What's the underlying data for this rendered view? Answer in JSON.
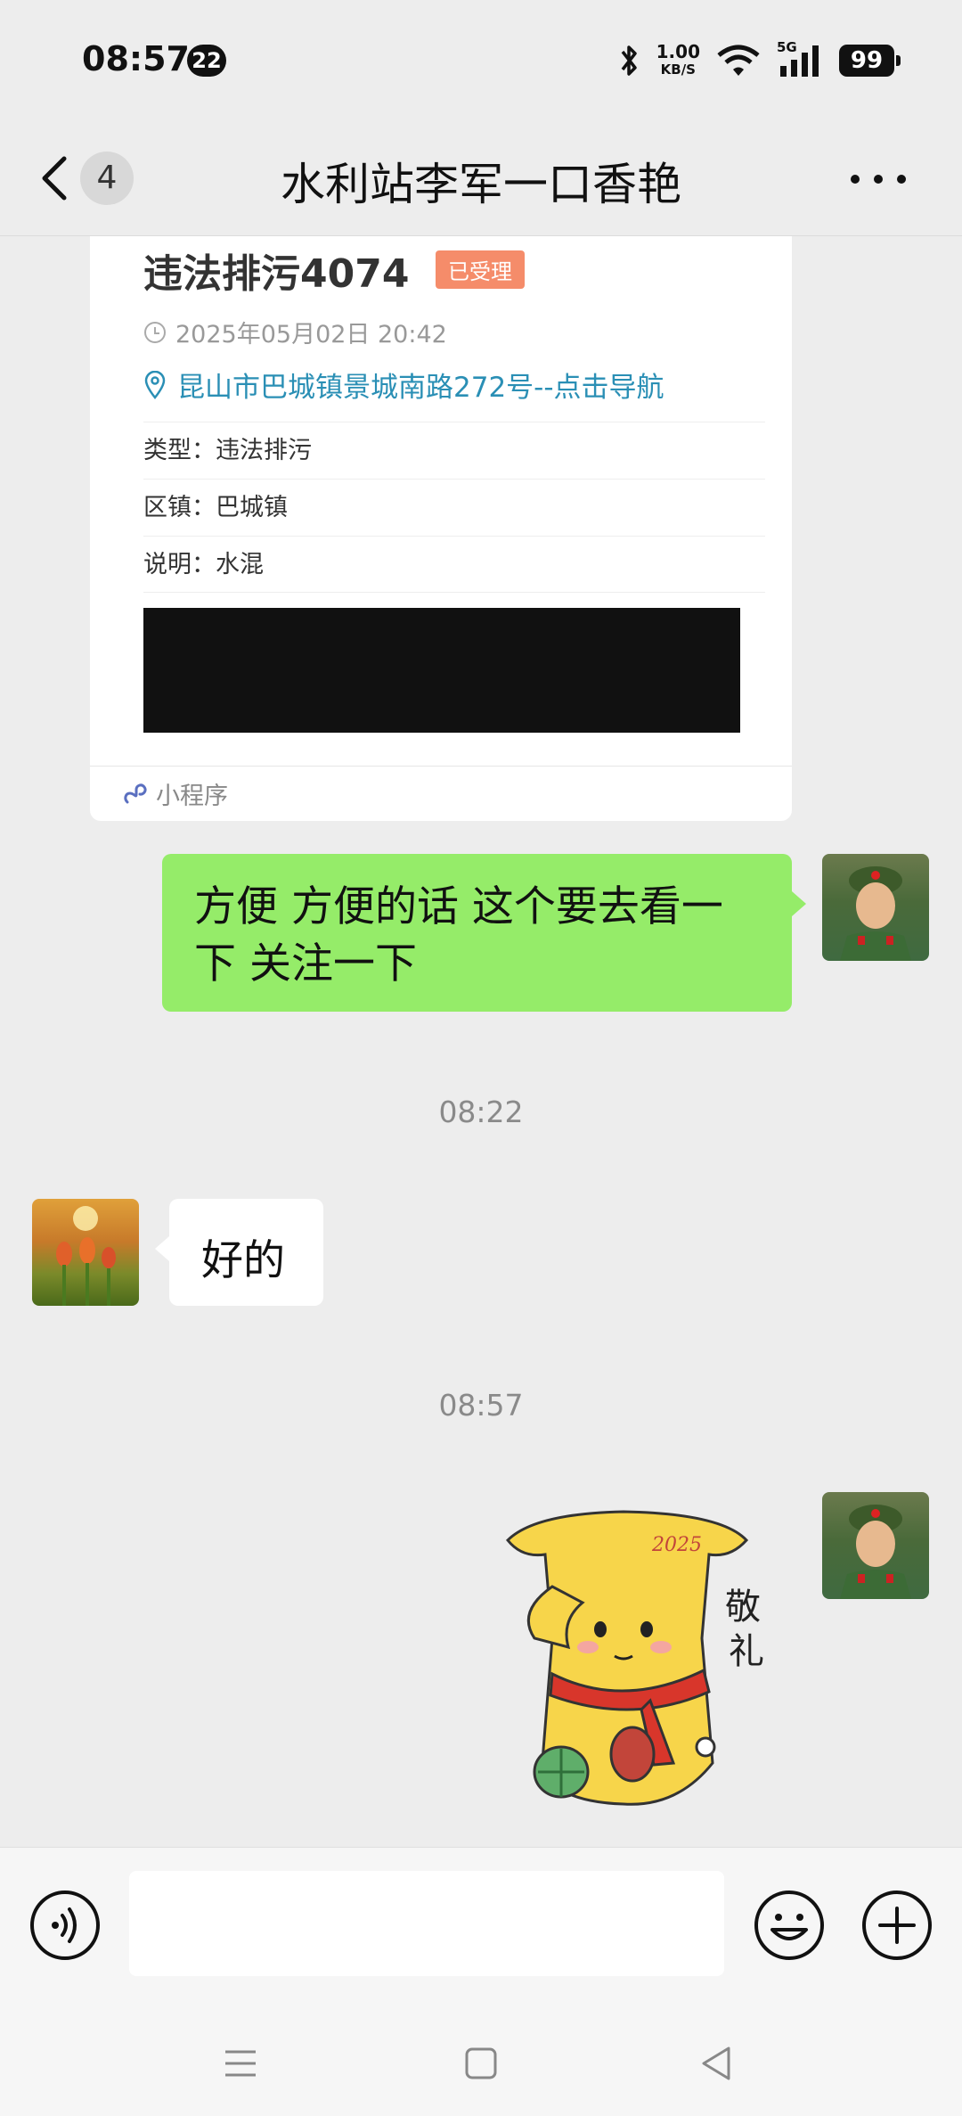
{
  "status_bar": {
    "time": "08:57",
    "notification_count": "22",
    "net_speed": "1.00",
    "net_speed_unit": "KB/S",
    "network": "5G",
    "battery": "99"
  },
  "header": {
    "unread_count": "4",
    "title": "水利站李军一口香艳"
  },
  "mini_program_card": {
    "title": "违法排污4074",
    "status": "已受理",
    "datetime": "2025年05月02日 20:42",
    "address": "昆山市巴城镇景城南路272号--点击导航",
    "rows": [
      {
        "label": "类型：",
        "value": "违法排污"
      },
      {
        "label": "区镇：",
        "value": "巴城镇"
      },
      {
        "label": "说明：",
        "value": "水混"
      }
    ],
    "footer_label": "小程序"
  },
  "messages": {
    "outgoing_text": "方便 方便的话 这个要去看一下 关注一下",
    "timestamp_1": "08:22",
    "incoming_text": "好的",
    "timestamp_2": "08:57",
    "sticker_text": "敬礼",
    "sticker_year": "2025"
  },
  "input_bar": {
    "placeholder": ""
  },
  "colors": {
    "outgoing_bubble": "#95ec69",
    "background": "#ededed",
    "status_badge": "#f58c6a",
    "link": "#2a8fb5"
  }
}
